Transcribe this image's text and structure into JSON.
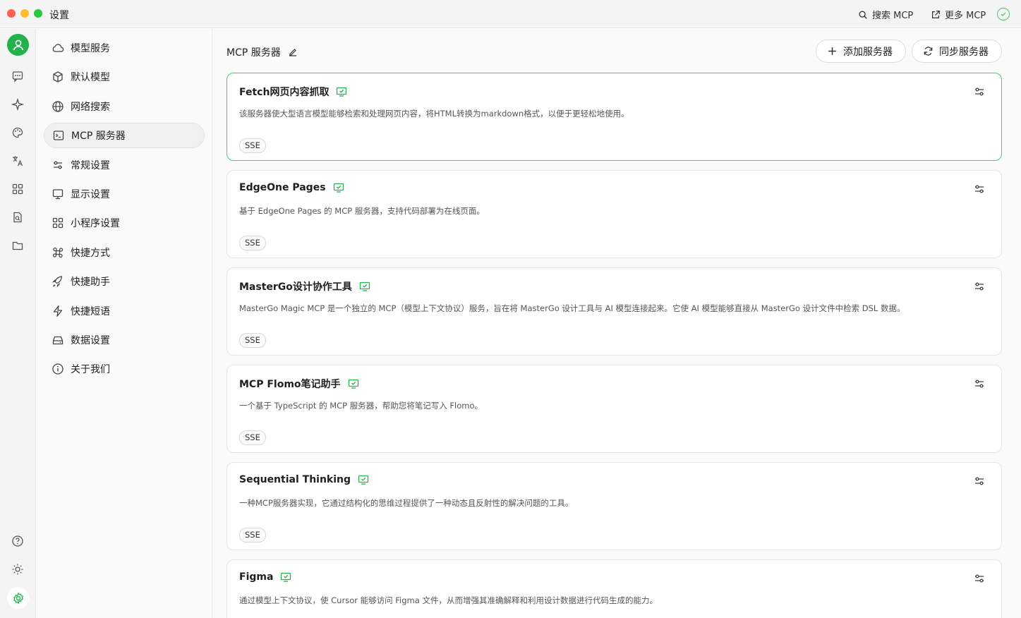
{
  "window": {
    "title": "设置"
  },
  "titlebar": {
    "search_label": "搜索 MCP",
    "more_label": "更多 MCP"
  },
  "rail": {
    "icons": [
      "avatar-icon",
      "chat-icon",
      "sparkle-icon",
      "palette-icon",
      "translate-icon",
      "apps-icon",
      "file-search-icon",
      "folder-icon",
      "help-icon",
      "sun-icon",
      "settings-icon"
    ]
  },
  "nav": {
    "items": [
      {
        "label": "模型服务",
        "icon": "cloud-icon"
      },
      {
        "label": "默认模型",
        "icon": "cube-icon"
      },
      {
        "label": "网络搜索",
        "icon": "globe-icon"
      },
      {
        "label": "MCP 服务器",
        "icon": "terminal-icon",
        "active": true
      },
      {
        "label": "常规设置",
        "icon": "sliders-icon"
      },
      {
        "label": "显示设置",
        "icon": "monitor-icon"
      },
      {
        "label": "小程序设置",
        "icon": "grid-icon"
      },
      {
        "label": "快捷方式",
        "icon": "command-icon"
      },
      {
        "label": "快捷助手",
        "icon": "rocket-icon"
      },
      {
        "label": "快捷短语",
        "icon": "zap-icon"
      },
      {
        "label": "数据设置",
        "icon": "drive-icon"
      },
      {
        "label": "关于我们",
        "icon": "info-icon"
      }
    ]
  },
  "main": {
    "title": "MCP 服务器",
    "add_label": "添加服务器",
    "sync_label": "同步服务器",
    "servers": [
      {
        "name": "Fetch网页内容抓取",
        "desc": "该服务器使大型语言模型能够检索和处理网页内容，将HTML转换为markdown格式，以便于更轻松地使用。",
        "tag": "SSE"
      },
      {
        "name": "EdgeOne Pages",
        "desc": "基于 EdgeOne Pages 的 MCP 服务器，支持代码部署为在线页面。",
        "tag": "SSE"
      },
      {
        "name": "MasterGo设计协作工具",
        "desc": "MasterGo Magic MCP 是一个独立的 MCP（模型上下文协议）服务，旨在将 MasterGo 设计工具与 AI 模型连接起来。它使 AI 模型能够直接从 MasterGo 设计文件中检索 DSL 数据。",
        "tag": "SSE"
      },
      {
        "name": "MCP Flomo笔记助手",
        "desc": "一个基于 TypeScript 的 MCP 服务器，帮助您将笔记写入 Flomo。",
        "tag": "SSE"
      },
      {
        "name": "Sequential Thinking",
        "desc": "一种MCP服务器实现，它通过结构化的思维过程提供了一种动态且反射性的解决问题的工具。",
        "tag": "SSE"
      },
      {
        "name": "Figma",
        "desc": "通过模型上下文协议，使 Cursor 能够访问 Figma 文件，从而增强其准确解释和利用设计数据进行代码生成的能力。",
        "tag": ""
      }
    ]
  },
  "colors": {
    "accent": "#22b14c",
    "selected_border": "#3fcf7a"
  }
}
